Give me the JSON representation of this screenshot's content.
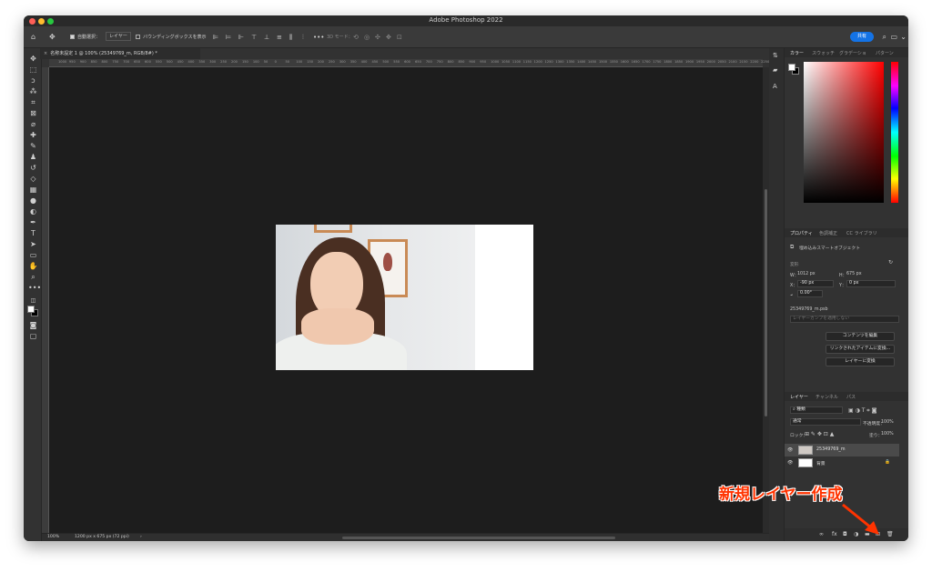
{
  "window": {
    "title": "Adobe Photoshop 2022"
  },
  "options_bar": {
    "auto_select_label": "自動選択：",
    "auto_select_value": "レイヤー",
    "bounding_box_label": "バウンディングボックスを表示",
    "mode_3d_label": "3D モード：",
    "share_label": "共有"
  },
  "document": {
    "tab_label": "名称未設定 1 @ 100% (25349769_m, RGB/8#) *",
    "zoom": "100%",
    "doc_info": "1200 px x 675 px (72 ppi)"
  },
  "ruler": {
    "ticks": [
      "1000",
      "950",
      "900",
      "850",
      "800",
      "750",
      "700",
      "650",
      "600",
      "550",
      "500",
      "450",
      "400",
      "350",
      "300",
      "250",
      "200",
      "150",
      "100",
      "50",
      "0",
      "50",
      "100",
      "150",
      "200",
      "250",
      "300",
      "350",
      "400",
      "450",
      "500",
      "550",
      "600",
      "650",
      "700",
      "750",
      "800",
      "850",
      "900",
      "950",
      "1000",
      "1050",
      "1100",
      "1150",
      "1200",
      "1250",
      "1300",
      "1350",
      "1400",
      "1450",
      "1500",
      "1550",
      "1600",
      "1650",
      "1700",
      "1750",
      "1800",
      "1850",
      "1900",
      "1950",
      "2000",
      "2050",
      "2100",
      "2150",
      "2200",
      "2250"
    ]
  },
  "color_panel": {
    "tabs": [
      "カラー",
      "スウォッチ",
      "グラデーショ",
      "パターン"
    ],
    "foreground": "#ffffff",
    "background": "#000000"
  },
  "properties_panel": {
    "tabs": [
      "プロパティ",
      "色調補正",
      "CC ライブラリ"
    ],
    "object_type": "埋め込みスマートオブジェクト",
    "transform_label": "変形",
    "w_label": "W：",
    "w_value": "1012 px",
    "h_label": "H：",
    "h_value": "675 px",
    "x_label": "X：",
    "x_value": "-90 px",
    "y_label": "Y：",
    "y_value": "0 px",
    "angle": "0.00°",
    "filename": "25349769_m.psb",
    "layer_comp_placeholder": "レイヤーカンプを適用しない",
    "btn_edit_contents": "コンテンツを編集",
    "btn_convert_linked": "リンクされたアイテムに変換...",
    "btn_convert_layer": "レイヤーに変換"
  },
  "layers_panel": {
    "tabs": [
      "レイヤー",
      "チャンネル",
      "パス"
    ],
    "filter_kind": "種類",
    "blend_mode": "通常",
    "opacity_label": "不透明度：",
    "opacity_value": "100%",
    "lock_label": "ロック：",
    "fill_label": "塗り：",
    "fill_value": "100%",
    "layers": [
      {
        "name": "25349769_m",
        "selected": true
      },
      {
        "name": "背景",
        "selected": false
      }
    ]
  },
  "annotation": {
    "text": "新規レイヤー作成",
    "color": "#ff3300"
  },
  "icons": [
    "home-icon",
    "move-tool-icon",
    "marquee-icon",
    "lasso-icon",
    "magic-wand-icon",
    "crop-icon",
    "frame-icon",
    "eyedropper-icon",
    "healing-icon",
    "brush-icon",
    "stamp-icon",
    "history-brush-icon",
    "eraser-icon",
    "gradient-icon",
    "blur-icon",
    "dodge-icon",
    "pen-icon",
    "type-icon",
    "path-select-icon",
    "rectangle-icon",
    "hand-icon",
    "zoom-icon",
    "search-icon",
    "trash-icon",
    "new-layer-icon",
    "folder-icon",
    "eye-icon"
  ]
}
